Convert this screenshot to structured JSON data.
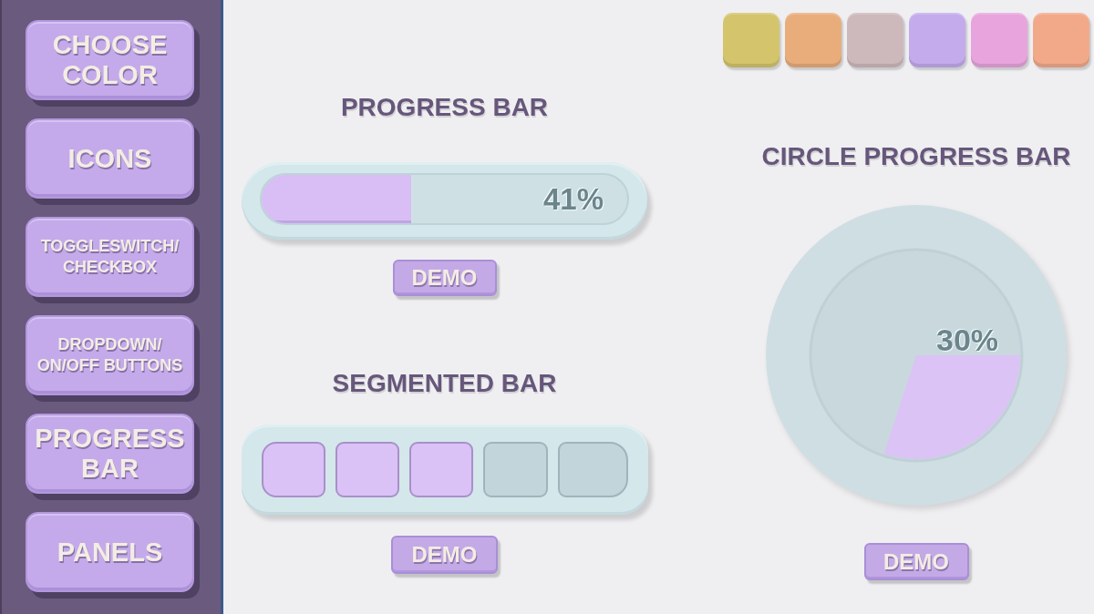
{
  "sidebar": {
    "items": [
      {
        "label": "CHOOSE\nCOLOR"
      },
      {
        "label": "ICONS"
      },
      {
        "label": "TOGGLESWITCH/\nCHECKBOX"
      },
      {
        "label": "DROPDOWN/\nON/OFF BUTTONS"
      },
      {
        "label": "PROGRESS\nBAR"
      },
      {
        "label": "PANELS"
      }
    ]
  },
  "color_swatches": [
    {
      "color": "#d4c46c"
    },
    {
      "color": "#e9ad7c"
    },
    {
      "color": "#cdb9bb"
    },
    {
      "color": "#c3abec"
    },
    {
      "color": "#e8a4dd"
    },
    {
      "color": "#f2a98a"
    }
  ],
  "progress_bar": {
    "title": "PROGRESS BAR",
    "level": 0.41,
    "reading": "41%",
    "button": "DEMO"
  },
  "segmented_bar": {
    "title": "SEGMENTED BAR",
    "segments": [
      {
        "filled": true
      },
      {
        "filled": true
      },
      {
        "filled": true
      },
      {
        "filled": false
      },
      {
        "filled": false
      }
    ],
    "button": "DEMO"
  },
  "circle_progress_bar": {
    "title": "CIRCLE PROGRESS BAR",
    "level": 0.3,
    "reading": "30%",
    "button": "DEMO"
  }
}
